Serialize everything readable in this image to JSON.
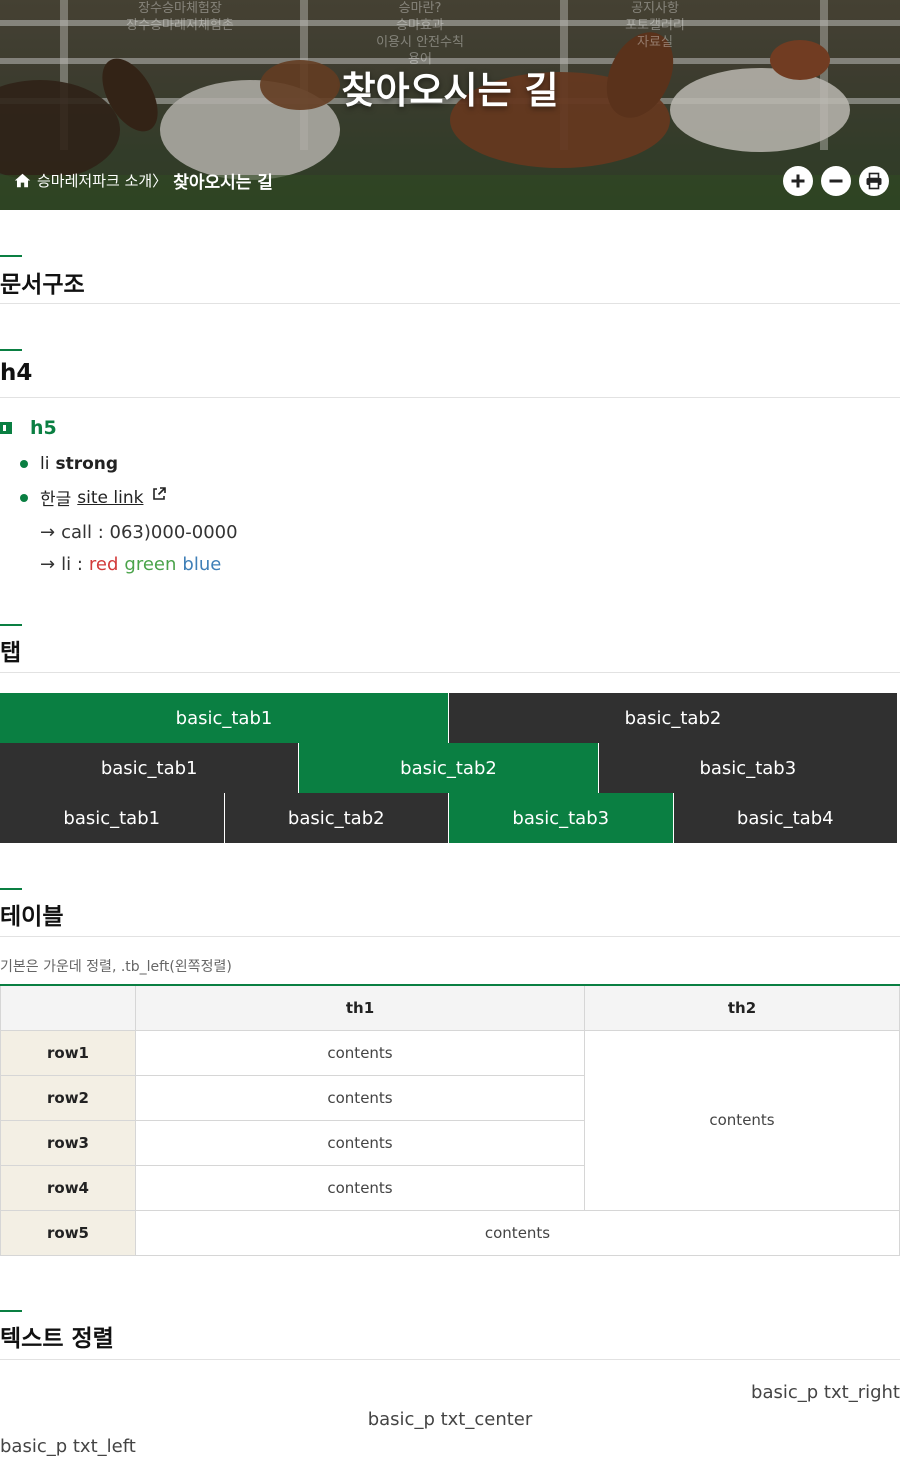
{
  "hero": {
    "title": "찾아오시는 길",
    "ghost_menu": [
      [
        "장수승마체험장",
        "장수승마레저체험촌"
      ],
      [
        "승마란?",
        "승마효과",
        "이용시 안전수칙",
        "용어"
      ],
      [
        "공지사항",
        "포토갤러리",
        "자료실"
      ]
    ]
  },
  "breadcrumb": {
    "parent": "승마레저파크 소개",
    "separator": "〉",
    "current": "찾아오시는 길"
  },
  "tools": {
    "zoom_in": "zoom-in",
    "zoom_out": "zoom-out",
    "print": "print"
  },
  "sections": {
    "doc": "문서구조",
    "h4": "h4",
    "tab": "탭",
    "table": "테이블",
    "text_align": "텍스트 정렬"
  },
  "doc": {
    "h5": "h5",
    "li1_plain": "li",
    "li1_strong": "strong",
    "li2_plain": "한글",
    "li2_link": "site link",
    "arrow": "→",
    "call_label": "call : 063)000-0000",
    "color_label": "li :",
    "red": "red",
    "green": "green",
    "blue": "blue"
  },
  "tabs": {
    "row1": [
      "basic_tab1",
      "basic_tab2"
    ],
    "row2": [
      "basic_tab1",
      "basic_tab2",
      "basic_tab3"
    ],
    "row3": [
      "basic_tab1",
      "basic_tab2",
      "basic_tab3",
      "basic_tab4"
    ],
    "active": [
      0,
      1,
      2
    ]
  },
  "table": {
    "caption": "기본은 가운데 정렬, .tb_left(왼쪽정렬)",
    "headers": [
      "",
      "th1",
      "th2"
    ],
    "rows": [
      "row1",
      "row2",
      "row3",
      "row4",
      "row5"
    ],
    "cell": "contents"
  },
  "text_align": {
    "right": "basic_p txt_right",
    "center": "basic_p txt_center",
    "left": "basic_p txt_left"
  },
  "colors": {
    "accent": "#0a7f42",
    "tab_dark": "#303030",
    "row_head": "#f3efe4"
  }
}
